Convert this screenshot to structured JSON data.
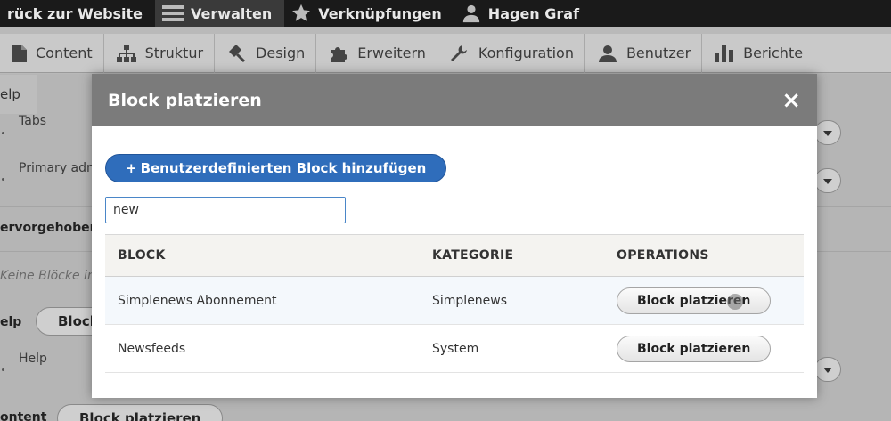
{
  "toolbar": {
    "back_label": "rück zur Website",
    "manage_label": "Verwalten",
    "shortcuts_label": "Verknüpfungen",
    "user_label": "Hagen Graf"
  },
  "tray": {
    "items": [
      {
        "label": "Content",
        "icon": "document-icon"
      },
      {
        "label": "Struktur",
        "icon": "structure-icon"
      },
      {
        "label": "Design",
        "icon": "paint-icon"
      },
      {
        "label": "Erweitern",
        "icon": "puzzle-icon"
      },
      {
        "label": "Konfiguration",
        "icon": "wrench-icon"
      },
      {
        "label": "Benutzer",
        "icon": "user-icon"
      },
      {
        "label": "Berichte",
        "icon": "chart-icon"
      }
    ]
  },
  "background": {
    "help_tab": "elp",
    "tabs_label": "Tabs",
    "primary_label": "Primary adm",
    "highlighted_region": "ervorgehoben",
    "no_blocks": "Keine Blöcke in d",
    "help_region": "elp",
    "help_button": "Block",
    "help_item": "Help",
    "content_region": "ontent",
    "content_button": "Block platzieren"
  },
  "modal": {
    "title": "Block platzieren",
    "close_label": "×",
    "add_button": "Benutzerdefinierten Block hinzufügen",
    "add_plus": "+",
    "search_value": "new",
    "columns": {
      "block": "BLOCK",
      "category": "KATEGORIE",
      "operations": "OPERATIONS"
    },
    "rows": [
      {
        "block": "Simplenews Abonnement",
        "category": "Simplenews",
        "action": "Block platzieren"
      },
      {
        "block": "Newsfeeds",
        "category": "System",
        "action": "Block platzieren"
      }
    ]
  },
  "colors": {
    "toolbar_bg": "#1a1a1a",
    "modal_header_bg": "#7b7b7b",
    "primary_button": "#2f6dbb",
    "search_border": "#4a86c8"
  }
}
